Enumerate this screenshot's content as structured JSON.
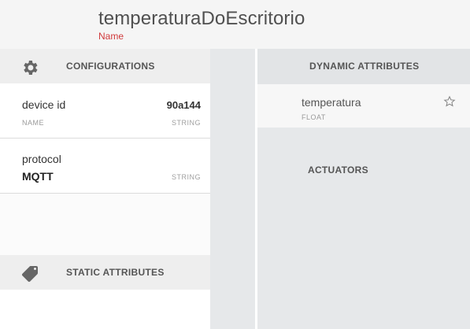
{
  "header": {
    "title": "temperaturaDoEscritorio",
    "subtitle": "Name"
  },
  "configurations": {
    "label": "CONFIGURATIONS",
    "icon": "gear-icon",
    "device_id": {
      "name": "device id",
      "value": "90a144",
      "left_meta": "NAME",
      "right_meta": "STRING"
    },
    "protocol": {
      "name": "protocol",
      "value": "MQTT",
      "right_meta": "STRING"
    }
  },
  "static_attributes": {
    "label": "STATIC ATTRIBUTES",
    "icon": "tag-icon"
  },
  "dynamic_attributes": {
    "label": "DYNAMIC ATTRIBUTES",
    "items": [
      {
        "name": "temperatura",
        "type": "FLOAT",
        "icon": "star-outline-icon"
      }
    ]
  },
  "actuators": {
    "label": "ACTUATORS"
  },
  "colors": {
    "accent": "#d0393b"
  }
}
